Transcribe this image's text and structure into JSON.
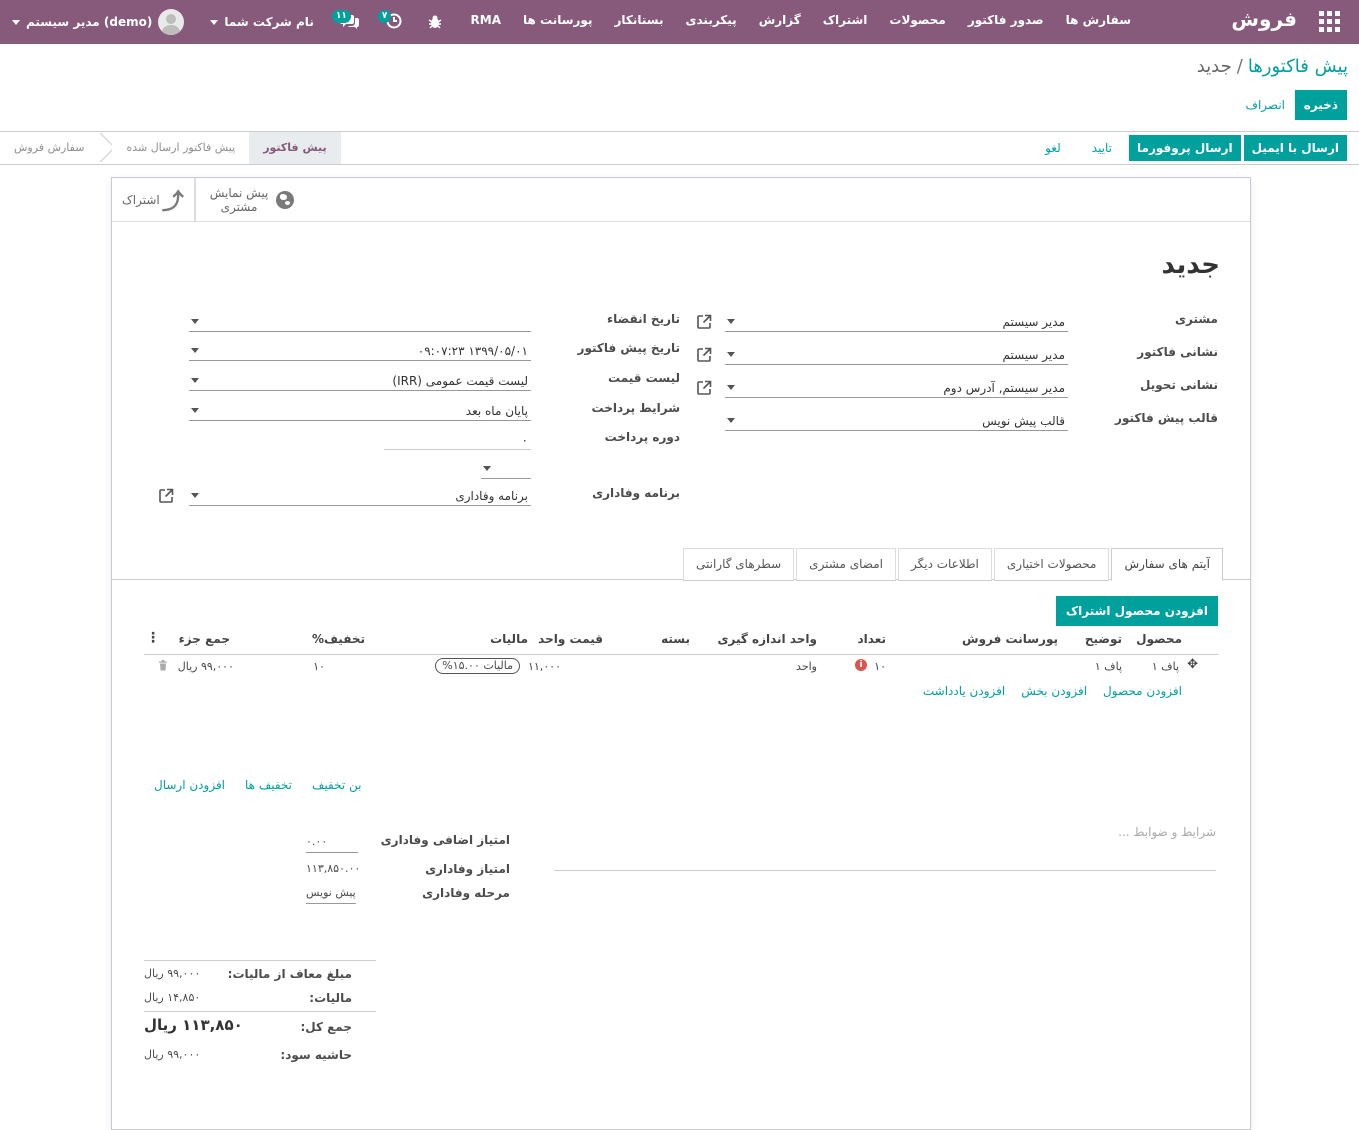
{
  "navbar": {
    "brand": "فروش",
    "menu": [
      "سفارش ها",
      "صدور فاکتور",
      "محصولات",
      "اشتراک",
      "گزارش",
      "پیکربندی",
      "بستانکار",
      "پورسانت ها",
      "RMA"
    ],
    "company": "نام شرکت شما",
    "user": "مدیر سیستم (demo)",
    "activity_count": "۷",
    "message_count": "۱۱"
  },
  "control": {
    "breadcrumb_parent": "پیش فاکتورها",
    "breadcrumb_sep": "/",
    "breadcrumb_current": "جدید",
    "save_label": "ذخیره",
    "discard_label": "انصراف"
  },
  "statusbar": {
    "buttons": [
      "ارسال با ایمیل",
      "ارسال پروفورما",
      "تایید",
      "لغو"
    ],
    "stages": [
      "سفارش فروش",
      "پیش فاکتور ارسال شده",
      "پیش فاکتور"
    ],
    "active_stage": "پیش فاکتور"
  },
  "smart_buttons": {
    "preview_line1": "پیش نمایش",
    "preview_line2": "مشتری",
    "share": "اشتراک"
  },
  "form": {
    "title": "جدید",
    "labels": {
      "customer": "مشتری",
      "invoice_address": "نشانی فاکتور",
      "delivery_address": "نشانی تحویل",
      "quote_template": "قالب پیش فاکتور",
      "expiration": "تاریخ انقضاء",
      "quotation_date": "تاریخ پیش فاکتور",
      "pricelist": "لیست قیمت",
      "payment_terms": "شرایط پرداخت",
      "payment_period": "دوره پرداخت",
      "loyalty_program": "برنامه وفاداری"
    },
    "values": {
      "customer": "مدیر سیستم",
      "invoice_address": "مدیر سیستم",
      "delivery_address": "مدیر سیستم, آدرس دوم",
      "quote_template": "قالب پیش نویس",
      "expiration": "",
      "quotation_date": "۱۳۹۹/۰۵/۰۱ ۰۹:۰۷:۲۳",
      "pricelist": "لیست قیمت عمومی (IRR)",
      "payment_terms": "پایان ماه بعد",
      "payment_period": "۰",
      "payment_period_unit": "",
      "loyalty_program": "برنامه وفاداری"
    }
  },
  "tabs": [
    "آیتم های سفارش",
    "محصولات اختیاری",
    "اطلاعات دیگر",
    "امضای مشتری",
    "سطرهای گارانتی"
  ],
  "order_lines": {
    "add_subscription_label": "افزودن محصول اشتراک",
    "headers": {
      "product": "محصول",
      "description": "توضیح",
      "commission": "پورسانت فروش",
      "quantity": "تعداد",
      "uom": "واحد اندازه گیری",
      "package": "بسته",
      "unit_price": "قیمت واحد",
      "taxes": "مالیات",
      "discount": "تخفیف%",
      "subtotal": "جمع جزء"
    },
    "rows": [
      {
        "product": "پاف ۱",
        "description": "پاف ۱",
        "quantity": "۱۰",
        "uom": "واحد",
        "unit_price": "۱۱,۰۰۰",
        "tax": "مالیات ۱۵.۰۰%",
        "discount": "۱۰",
        "subtotal": "۹۹,۰۰۰ ریال"
      }
    ],
    "add_product": "افزودن محصول",
    "add_section": "افزودن بخش",
    "add_note": "افزودن یادداشت"
  },
  "discount_links": [
    "بن تخفیف",
    "تخفیف ها",
    "افزودن ارسال"
  ],
  "terms_placeholder": "شرایط و ضوابط ...",
  "loyalty": {
    "extra_points_label": "امتیاز اضافی وفاداری",
    "extra_points": "۰.۰۰",
    "points_label": "امتیاز وفاداری",
    "points": "۱۱۳,۸۵۰.۰۰",
    "stage_label": "مرحله وفاداری",
    "stage": "پیش نویس"
  },
  "totals": {
    "untaxed_label": "مبلغ معاف از مالیات:",
    "untaxed": "۹۹,۰۰۰ ریال",
    "taxes_label": "مالیات:",
    "taxes": "۱۴,۸۵۰ ریال",
    "total_label": "جمع کل:",
    "total": "۱۱۳,۸۵۰ ریال",
    "margin_label": "حاشیه سود:",
    "margin": "۹۹,۰۰۰ ریال"
  },
  "colors": {
    "navbar": "#875a7b",
    "primary": "#00a09d",
    "danger": "#d9534f"
  }
}
